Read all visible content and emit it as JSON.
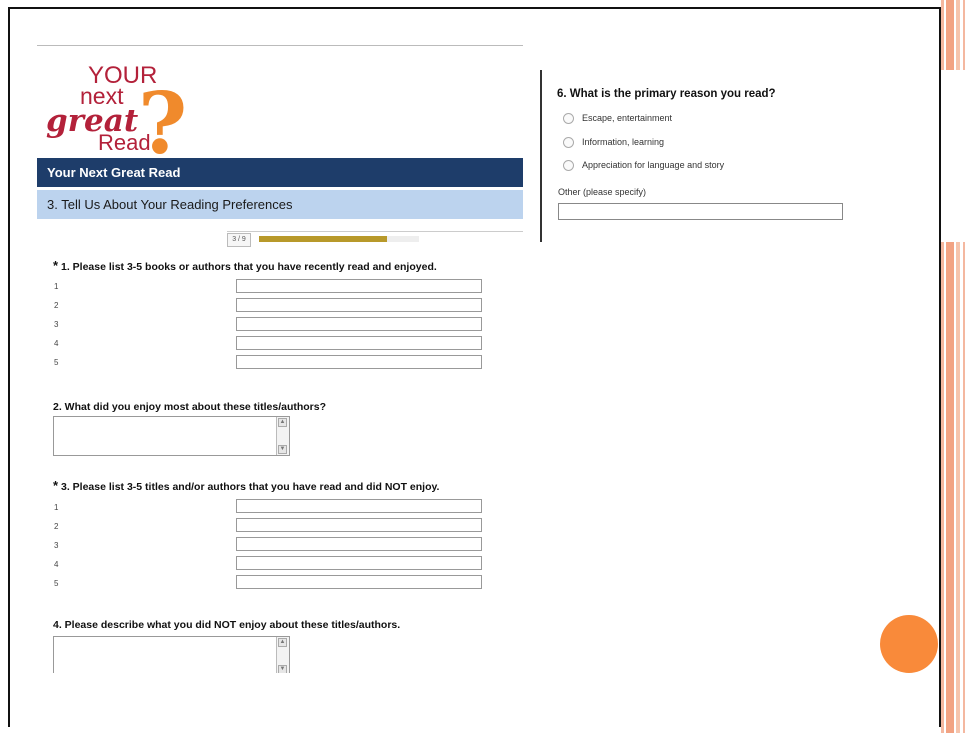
{
  "logo": {
    "line1": "YOUR",
    "line2": "next",
    "line3": "great",
    "line4": "Read",
    "mark": "?"
  },
  "survey": {
    "header_title": "Your Next Great Read",
    "section_title": "3. Tell Us About Your Reading Preferences",
    "progress": {
      "label": "3 / 9",
      "fraction": 0.8
    },
    "q1": {
      "star": "*",
      "text": "1. Please list 3-5 books or authors that you have recently read and enjoyed.",
      "rows": [
        "1",
        "2",
        "3",
        "4",
        "5"
      ]
    },
    "q2": {
      "text": "2. What did you enjoy most about these titles/authors?"
    },
    "q3": {
      "star": "*",
      "text": "3. Please list 3-5 titles and/or authors that you have read and did NOT enjoy.",
      "rows": [
        "1",
        "2",
        "3",
        "4",
        "5"
      ]
    },
    "q4": {
      "text": "4. Please describe what you did NOT enjoy about these titles/authors."
    }
  },
  "right_panel": {
    "q6": "6. What is the primary reason you read?",
    "options": [
      "Escape, entertainment",
      "Information, learning",
      "Appreciation for language and story"
    ],
    "other_label": "Other (please specify)"
  },
  "colors": {
    "header": "#1e3d6a",
    "section": "#bcd3ee",
    "progress": "#b8992a",
    "accent_orange": "#f98a3a",
    "logo_red": "#b3213a",
    "logo_orange": "#f08a2c"
  }
}
